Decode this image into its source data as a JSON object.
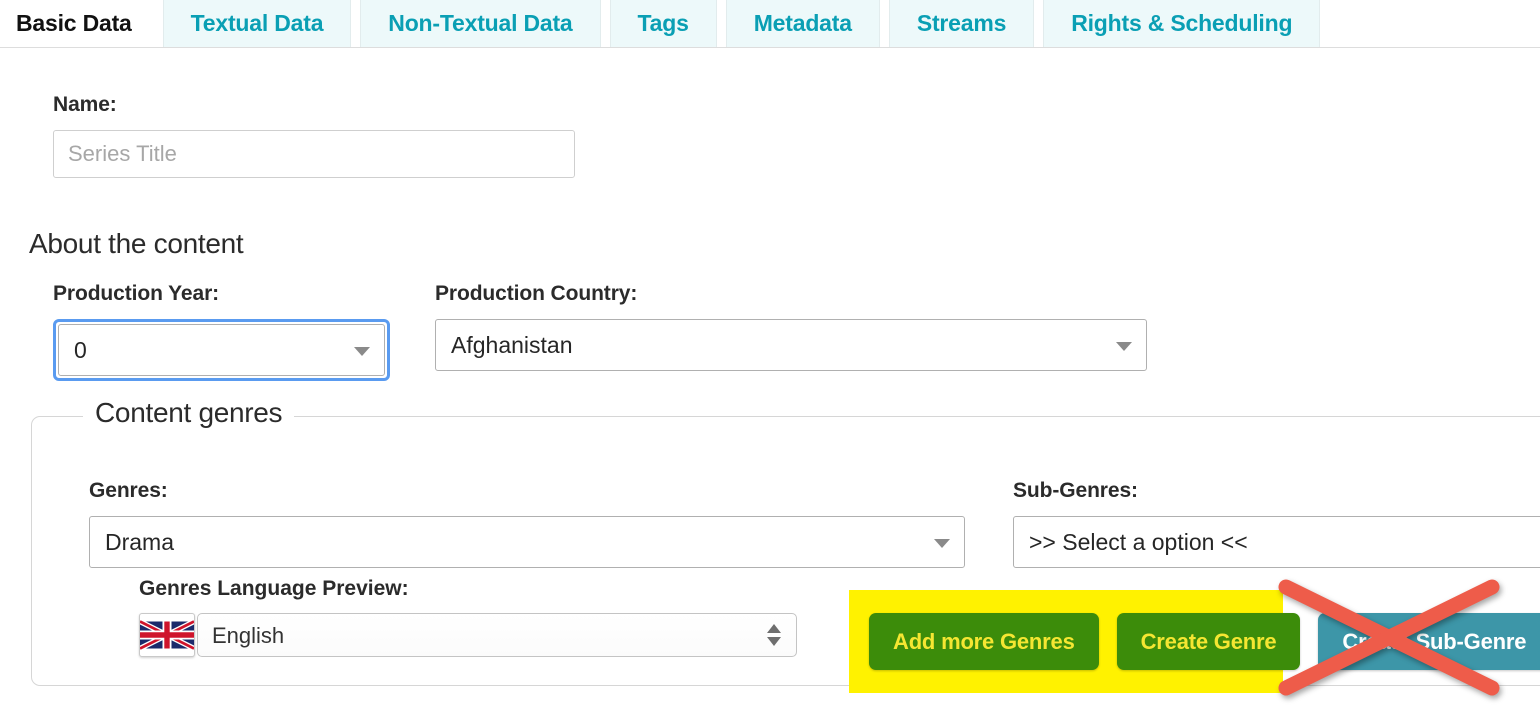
{
  "tabs": [
    {
      "label": "Basic Data",
      "active": true
    },
    {
      "label": "Textual Data",
      "active": false
    },
    {
      "label": "Non-Textual Data",
      "active": false
    },
    {
      "label": "Tags",
      "active": false
    },
    {
      "label": "Metadata",
      "active": false
    },
    {
      "label": "Streams",
      "active": false
    },
    {
      "label": "Rights & Scheduling",
      "active": false
    }
  ],
  "form": {
    "name_label": "Name:",
    "name_value": "",
    "name_placeholder": "Series Title",
    "about_heading": "About the content",
    "production_year_label": "Production Year:",
    "production_year_value": "0",
    "production_country_label": "Production Country:",
    "production_country_value": "Afghanistan"
  },
  "genres": {
    "legend": "Content genres",
    "genres_label": "Genres:",
    "genres_value": "Drama",
    "subgenres_label": "Sub-Genres:",
    "subgenres_value": ">> Select a option <<",
    "language_preview_label": "Genres Language Preview:",
    "language_preview_value": "English",
    "language_flag": "uk-flag-icon"
  },
  "buttons": {
    "add_more_genres": "Add more Genres",
    "create_genre": "Create Genre",
    "create_sub_genre": "Create Sub-Genre"
  },
  "annotations": {
    "highlight_color": "#fff200",
    "cross_out_color": "#ee5c4a",
    "cross_out_target": "Create Sub-Genre"
  },
  "colors": {
    "tab_text": "#0a9fb4",
    "tab_background": "#edf9fa",
    "green_button": "#3c8c0a",
    "green_button_text": "#f5e632",
    "teal_button": "#3d96a8",
    "focus_ring": "#5a9bf0"
  }
}
